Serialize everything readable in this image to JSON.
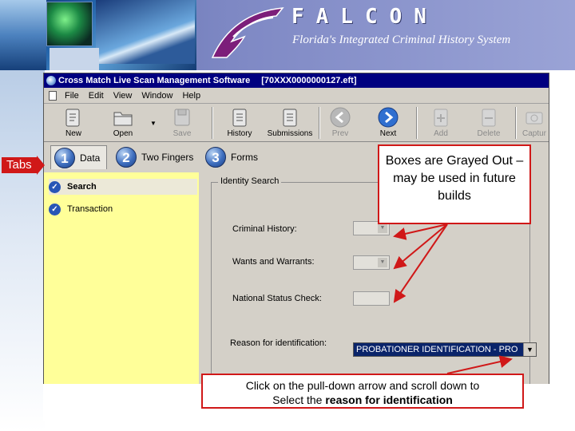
{
  "banner": {
    "title": "FALCON",
    "subtitle": "Florida's Integrated Criminal History System"
  },
  "window": {
    "title": "Cross Match Live Scan Management Software",
    "file": "[70XXX0000000127.eft]"
  },
  "menu": [
    "File",
    "Edit",
    "View",
    "Window",
    "Help"
  ],
  "toolbar": {
    "new": "New",
    "open": "Open",
    "save": "Save",
    "history": "History",
    "submissions": "Submissions",
    "prev": "Prev",
    "next": "Next",
    "add": "Add",
    "delete": "Delete",
    "capture": "Captur"
  },
  "tabs": [
    {
      "num": "1",
      "label": "Data"
    },
    {
      "num": "2",
      "label": "Two Fingers"
    },
    {
      "num": "3",
      "label": "Forms"
    }
  ],
  "left_nav": [
    {
      "label": "Search"
    },
    {
      "label": "Transaction"
    }
  ],
  "form": {
    "group_title": "Identity Search",
    "criminal_history_label": "Criminal History:",
    "wants_label": "Wants and Warrants:",
    "national_label": "National Status Check:",
    "reason_label": "Reason for identification:",
    "reason_value": "PROBATIONER IDENTIFICATION - PRO"
  },
  "annotations": {
    "tabs": "Tabs",
    "grayed": "Boxes are Grayed Out – may be used in future builds",
    "pulldown_line1": "Click on the pull-down arrow and scroll down to",
    "pulldown_line2_prefix": "Select the",
    "pulldown_line2_bold": "reason for identification",
    "color": "#d01818"
  }
}
